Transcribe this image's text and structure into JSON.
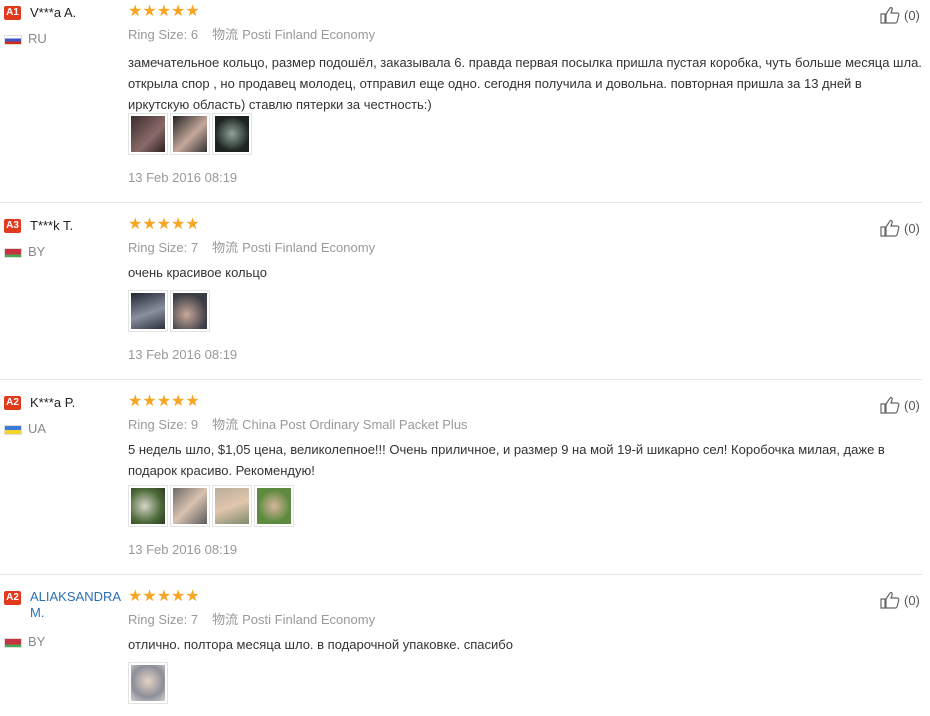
{
  "ring_size_label": "Ring Size:",
  "shipping_icon_glyph": "物流",
  "reviews": [
    {
      "badge": "A1",
      "user": "V***a A.",
      "country": "RU",
      "rating": 5,
      "ring_size": "6",
      "shipping": "Posti Finland Economy",
      "text": "замечательное кольцо, размер подошёл, заказывала 6. правда первая посылка пришла пустая коробка, чуть больше месяца шла. открыла спор , но продавец молодец, отправил еще одно. сегодня получила и довольна. повторная пришла за 13 дней в иркутскую область) ставлю пятерки за честность:)",
      "date": "13 Feb 2016 08:19",
      "helpful": "(0)",
      "photo_count": 3
    },
    {
      "badge": "A3",
      "user": "T***k T.",
      "country": "BY",
      "rating": 5,
      "ring_size": "7",
      "shipping": "Posti Finland Economy",
      "text": "очень красивое кольцо",
      "date": "13 Feb 2016 08:19",
      "helpful": "(0)",
      "photo_count": 2
    },
    {
      "badge": "A2",
      "user": "K***a P.",
      "country": "UA",
      "rating": 5,
      "ring_size": "9",
      "shipping": "China Post Ordinary Small Packet Plus",
      "text": "5 недель шло, $1,05 цена, великолепное!!! Очень приличное, и размер 9 на мой 19-й шикарно сел! Коробочка милая, даже в подарок красиво. Рекомендую!",
      "date": "13 Feb 2016 08:19",
      "helpful": "(0)",
      "photo_count": 4
    },
    {
      "badge": "A2",
      "user": "ALIAKSANDRA M.",
      "country": "BY",
      "rating": 5,
      "ring_size": "7",
      "shipping": "Posti Finland Economy",
      "text": "отлично. полтора месяца шло. в подарочной упаковке. спасибо",
      "helpful": "(0)",
      "photo_count": 1
    }
  ],
  "colors": {
    "badge": "#e0391c",
    "star": "#f6a623",
    "link": "#2a6fb6"
  },
  "icons": {
    "rating": "star-icon",
    "helpful": "thumbs-up-icon",
    "shipping": "logistics-icon"
  }
}
